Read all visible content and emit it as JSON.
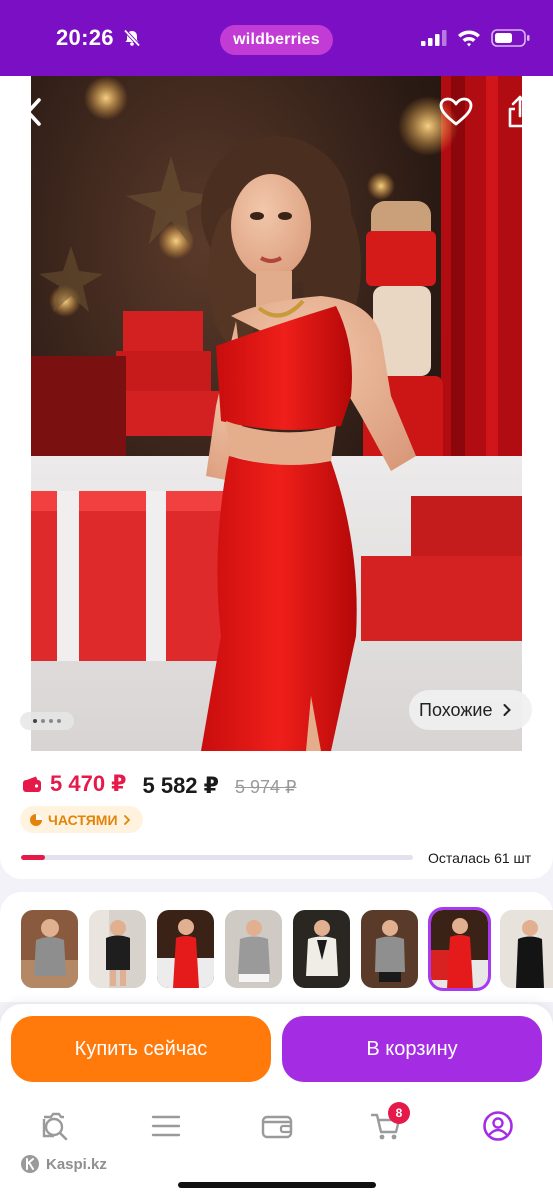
{
  "status_bar": {
    "time": "20:26",
    "brand": "wildberries",
    "accent": "#7a0fc3"
  },
  "gallery": {
    "image_alt": "Красное платье",
    "similar_label": "Похожие",
    "page_count": 4,
    "current_page": 1
  },
  "price": {
    "wallet_price": "5 470 ₽",
    "price": "5 582 ₽",
    "old_price": "5 974 ₽",
    "installment_label": "ЧАСТЯМИ",
    "stock_text": "Осталась 61 шт",
    "stock_progress": 0.06,
    "wallet_color": "#e5194a"
  },
  "variants": {
    "count": 8,
    "selected_index": 6
  },
  "actions": {
    "buy_now_label": "Купить сейчас",
    "add_to_cart_label": "В корзину",
    "buy_color": "#ff7a0a",
    "cart_color": "#a42de3"
  },
  "bottom_nav": {
    "items": [
      "search-icon",
      "menu-icon",
      "wallet-icon",
      "cart-icon",
      "profile-icon"
    ],
    "cart_badge": "8",
    "active_index": 4
  },
  "watermark": "Kaspi.kz"
}
